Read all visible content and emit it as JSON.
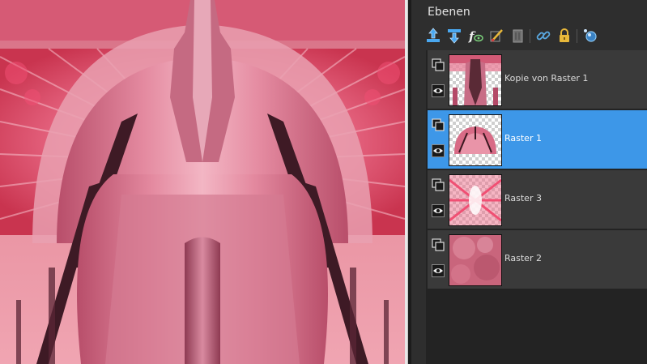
{
  "panel": {
    "title": "Ebenen",
    "toolbar": [
      {
        "icon": "new-raster-layer-icon",
        "color": "#4aa8f0"
      },
      {
        "icon": "merge-down-icon",
        "color": "#4aa8f0"
      },
      {
        "icon": "layer-effects-icon",
        "color": "#dddddd"
      },
      {
        "icon": "brush-mask-icon",
        "color": "#e8b83a"
      },
      {
        "icon": "delete-layer-icon",
        "color": "#8a8a8a"
      },
      {
        "icon": "link-icon",
        "color": "#5aa8e0"
      },
      {
        "icon": "lock-icon",
        "color": "#e8b83a"
      },
      {
        "icon": "layer-properties-icon",
        "color": "#5aa8e0"
      }
    ],
    "layers": [
      {
        "name": "Kopie von Raster 1",
        "selected": false
      },
      {
        "name": "Raster 1",
        "selected": true
      },
      {
        "name": "Raster 3",
        "selected": false
      },
      {
        "name": "Raster 2",
        "selected": false
      }
    ]
  },
  "colors": {
    "accent": "#3d97e8",
    "panel_bg": "#2e2e2e",
    "layer_bg": "#3a3a3a",
    "art_pink": "#e58a9b",
    "art_dark": "#4a1f2c"
  }
}
